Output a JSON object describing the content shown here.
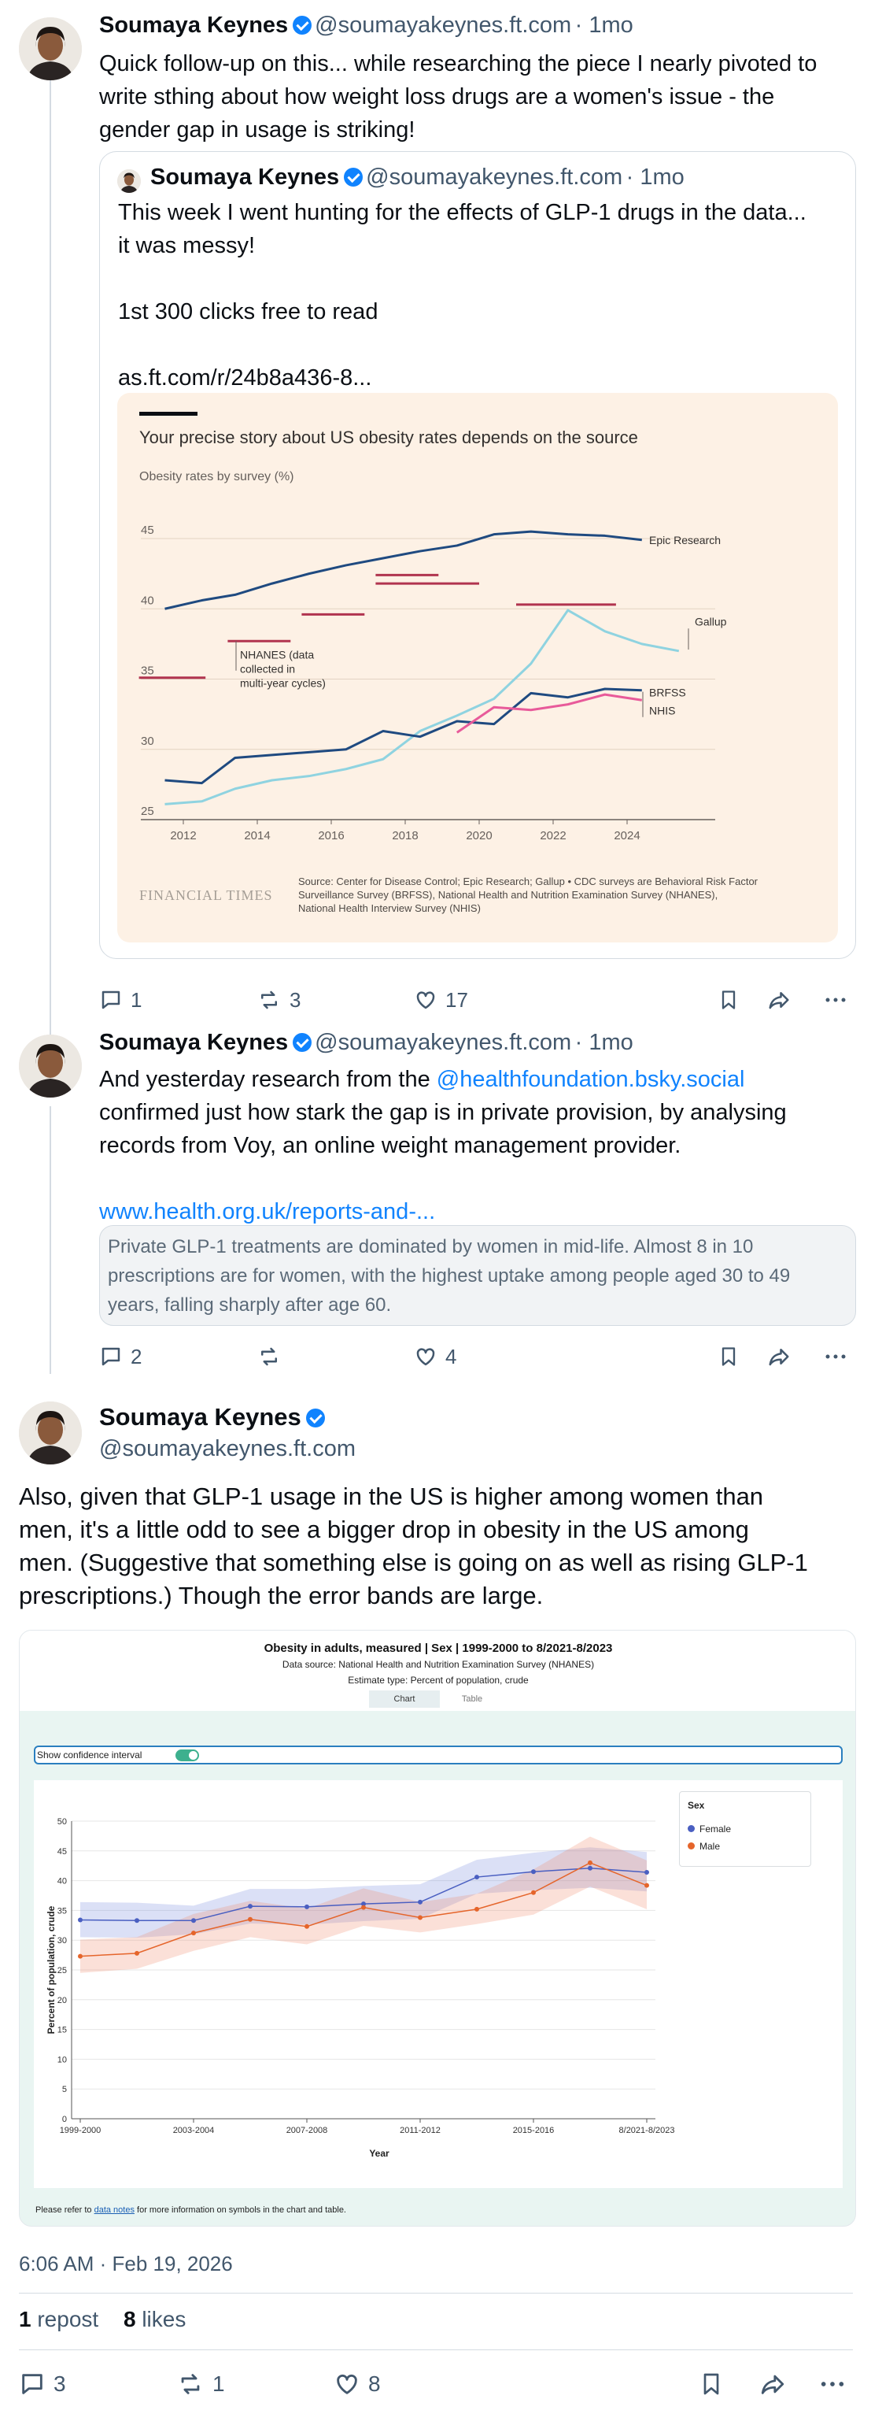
{
  "colors": {
    "ft_background": "#fdf1e5",
    "ft_navy": "#1f4a80",
    "ft_lightblue": "#8fd3e0",
    "ft_pink": "#e85a9a",
    "ft_claret": "#b1344f",
    "link": "#1083fe",
    "nhanes_female": "#4a5fc1",
    "nhanes_male": "#e5652b"
  },
  "post1": {
    "author": "Soumaya Keynes",
    "handle": "@soumayakeynes.ft.com",
    "time": "· 1mo",
    "text_lines": [
      "Quick follow-up on this... while researching the piece I nearly pivoted to",
      "write sthing about how weight loss drugs are a women's issue - the",
      "gender gap in usage is striking!"
    ],
    "quoted": {
      "author": "Soumaya Keynes",
      "handle": "@soumayakeynes.ft.com",
      "time": "· 1mo",
      "line1": "This week I went hunting for the effects of GLP-1 drugs in the data...",
      "line2": "it was messy!",
      "line3": "1st 300 clicks free to read",
      "line4": "as.ft.com/r/24b8a436-8..."
    },
    "actions": {
      "replies": "1",
      "reposts": "3",
      "likes": "17"
    }
  },
  "ft_chart": {
    "title": "Your precise story about US obesity rates depends on the source",
    "subtitle": "Obesity rates by survey (%)",
    "brand": "FINANCIAL TIMES",
    "source_line1": "Source: Center for Disease Control; Epic Research; Gallup • CDC surveys are Behavioral Risk Factor",
    "source_line2": "Surveillance Survey (BRFSS), National Health and Nutrition Examination Survey (NHANES),",
    "source_line3": "National Health Interview Survey (NHIS)",
    "nhanes_note": [
      "NHANES (data",
      "collected in",
      "multi-year cycles)"
    ]
  },
  "chart_data": [
    {
      "type": "line",
      "title": "Your precise story about US obesity rates depends on the source",
      "ylabel": "Obesity rates by survey (%)",
      "xlim": [
        2011,
        2026
      ],
      "ylim": [
        25,
        46
      ],
      "x_ticks": [
        2012,
        2014,
        2016,
        2018,
        2020,
        2022,
        2024
      ],
      "y_ticks": [
        25,
        30,
        35,
        40,
        45
      ],
      "grid": true,
      "series": [
        {
          "name": "Epic Research",
          "x": [
            2011.5,
            2012.5,
            2013.4,
            2014.4,
            2015.4,
            2016.4,
            2017.4,
            2018.4,
            2019.4,
            2020.4,
            2021.4,
            2022.4,
            2023.4,
            2024.4
          ],
          "y": [
            40.0,
            40.6,
            41.0,
            41.8,
            42.5,
            43.1,
            43.6,
            44.1,
            44.5,
            45.3,
            45.5,
            45.3,
            45.2,
            44.9
          ]
        },
        {
          "name": "Gallup",
          "x": [
            2011.5,
            2012.5,
            2013.4,
            2014.4,
            2015.4,
            2016.4,
            2017.4,
            2018.4,
            2019.4,
            2020.4,
            2021.4,
            2022.4,
            2023.4,
            2024.4,
            2025.4
          ],
          "y": [
            26.1,
            26.3,
            27.2,
            27.8,
            28.1,
            28.6,
            29.3,
            31.3,
            32.4,
            33.6,
            36.1,
            39.9,
            38.4,
            37.5,
            37.0
          ]
        },
        {
          "name": "BRFSS",
          "x": [
            2011.5,
            2012.5,
            2013.4,
            2014.4,
            2015.4,
            2016.4,
            2017.4,
            2018.4,
            2019.4,
            2020.4,
            2021.4,
            2022.4,
            2023.4,
            2024.4
          ],
          "y": [
            27.8,
            27.6,
            29.4,
            29.6,
            29.8,
            30.0,
            31.3,
            30.9,
            32.0,
            31.8,
            34.0,
            33.7,
            34.3,
            34.2
          ]
        },
        {
          "name": "NHIS",
          "x": [
            2019.4,
            2020.4,
            2021.4,
            2022.4,
            2023.4,
            2024.4
          ],
          "y": [
            31.2,
            33.0,
            32.8,
            33.2,
            33.9,
            33.5
          ]
        },
        {
          "name": "NHANES (data collected in multi-year cycles)",
          "segments": [
            {
              "x": [
                2010.8,
                2012.6
              ],
              "y": 35.1
            },
            {
              "x": [
                2013.2,
                2014.9
              ],
              "y": 37.7
            },
            {
              "x": [
                2015.2,
                2016.9
              ],
              "y": 39.6
            },
            {
              "x": [
                2017.2,
                2018.9
              ],
              "y": 42.4
            },
            {
              "x": [
                2017.2,
                2020.0
              ],
              "y": 41.8
            },
            {
              "x": [
                2021.0,
                2023.7
              ],
              "y": 40.3
            }
          ]
        }
      ]
    },
    {
      "type": "line",
      "title": "Obesity in adults, measured | Sex | 1999-2000 to 8/2021-8/2023",
      "xlabel": "Year",
      "ylabel": "Percent of population, crude",
      "ylim": [
        0,
        50
      ],
      "y_ticks": [
        0,
        5,
        10,
        15,
        20,
        25,
        30,
        35,
        40,
        45,
        50
      ],
      "categories": [
        "1999-2000",
        "2001-2002",
        "2003-2004",
        "2005-2006",
        "2007-2008",
        "2009-2010",
        "2011-2012",
        "2013-2014",
        "2015-2016",
        "2017-2018",
        "8/2021-8/2023"
      ],
      "x_tick_labels": [
        "1999-2000",
        "2003-2004",
        "2007-2008",
        "2011-2012",
        "2015-2016",
        "8/2021-8/2023"
      ],
      "legend": "top-right",
      "confidence_interval": true,
      "series": [
        {
          "name": "Female",
          "values": [
            33.4,
            33.3,
            33.3,
            35.7,
            35.6,
            36.1,
            36.4,
            40.6,
            41.5,
            42.1,
            41.4
          ],
          "ci_low": [
            30.5,
            30.4,
            31.0,
            32.8,
            32.6,
            33.2,
            33.6,
            37.8,
            38.4,
            38.8,
            38.2
          ],
          "ci_high": [
            36.4,
            36.3,
            35.8,
            38.6,
            38.6,
            39.1,
            39.4,
            43.5,
            44.7,
            45.6,
            44.8
          ]
        },
        {
          "name": "Male",
          "values": [
            27.3,
            27.8,
            31.2,
            33.5,
            32.3,
            35.5,
            33.8,
            35.2,
            38.0,
            43.0,
            39.2
          ],
          "ci_low": [
            24.5,
            25.2,
            28.2,
            30.5,
            29.3,
            32.4,
            31.3,
            32.7,
            34.3,
            39.0,
            35.2
          ],
          "ci_high": [
            30.1,
            30.5,
            34.4,
            36.6,
            35.3,
            38.7,
            36.4,
            37.8,
            41.9,
            47.4,
            43.4
          ]
        }
      ]
    }
  ],
  "post2": {
    "author": "Soumaya Keynes",
    "handle": "@soumayakeynes.ft.com",
    "time": "· 1mo",
    "line1": "And yesterday research from the",
    "mention": "@healthfoundation.bsky.social",
    "line2": "confirmed just how stark the gap is in private provision, by analysing",
    "line3": "records from Voy, an online weight management provider.",
    "url": "www.health.org.uk/reports-and-...",
    "quote_lines": [
      "Private GLP-1 treatments are dominated by women in mid-life. Almost 8 in 10",
      "prescriptions are for women, with the highest uptake among people aged 30 to 49",
      "years, falling sharply after age 60."
    ],
    "actions": {
      "replies": "2",
      "reposts": "",
      "likes": "4"
    }
  },
  "post3": {
    "author": "Soumaya Keynes",
    "handle": "@soumayakeynes.ft.com",
    "text_lines": [
      "Also, given that GLP-1 usage in the US is higher among women than",
      "men, it's a little odd to see a bigger drop in obesity in the US among",
      "men. (Suggestive that something else is going on as well as rising GLP-1",
      "prescriptions.) Though the error bands are large."
    ],
    "timestamp": "6:06 AM · Feb 19, 2026",
    "repost_count": "1",
    "repost_label": "repost",
    "like_count": "8",
    "like_label": "likes",
    "actions": {
      "replies": "3",
      "reposts": "1",
      "likes": "8"
    }
  },
  "nhanes_chart": {
    "title": "Obesity in adults, measured | Sex | 1999-2000 to 8/2021-8/2023",
    "source": "Data source: National Health and Nutrition Examination Survey (NHANES)",
    "estimate": "Estimate type: Percent of population, crude",
    "tab_chart": "Chart",
    "tab_table": "Table",
    "toggle_label": "Show confidence interval",
    "legend_title": "Sex",
    "xlabel": "Year",
    "ylabel": "Percent of population, crude",
    "footer_pre": "Please refer to ",
    "footer_link": "data notes",
    "footer_post": " for more information on symbols in the chart and table."
  }
}
